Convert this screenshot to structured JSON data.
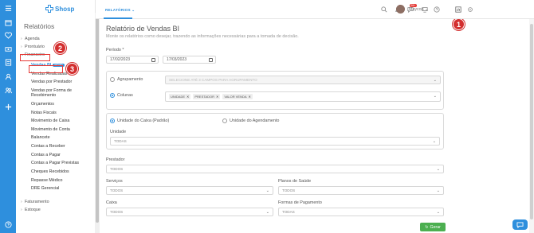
{
  "brand": {
    "name": "Shosp"
  },
  "sidebar": {
    "title": "Relatórios",
    "items": [
      {
        "label": "Agenda",
        "type": "section"
      },
      {
        "label": "Prontuário",
        "type": "section"
      },
      {
        "label": "Financeiro",
        "type": "section-open"
      }
    ],
    "financeiro_items": [
      {
        "label": "Vendas BI",
        "badge": "NOVO"
      },
      {
        "label": "Vendas Realizadas"
      },
      {
        "label": "Vendas por Prestador"
      },
      {
        "label": "Vendas por Forma de Recebimento"
      },
      {
        "label": "Orçamentos"
      },
      {
        "label": "Notas Fiscais"
      },
      {
        "label": "Movimento de Caixa"
      },
      {
        "label": "Movimento de Conta"
      },
      {
        "label": "Balancete"
      },
      {
        "label": "Contas a Receber"
      },
      {
        "label": "Contas a Pagar"
      },
      {
        "label": "Contas a Pagar Previstas"
      },
      {
        "label": "Cheques Recebidos"
      },
      {
        "label": "Repasse Médico"
      },
      {
        "label": "DRE Gerencial"
      }
    ],
    "bottom_items": [
      {
        "label": "Faturamento"
      },
      {
        "label": "Estoque"
      }
    ]
  },
  "annotations": {
    "one": "1",
    "two": "2",
    "three": "3"
  },
  "topbar": {
    "tab": "RELATÓRIOS",
    "badge_count": "99+",
    "user_name": "Maycon"
  },
  "main": {
    "title": "Relatório de Vendas BI",
    "subtitle": "Monte os relatórios como desejar, trazendo as informações necessárias para a tomada de decisão.",
    "periodo_label": "Período *",
    "date_start": "17/02/2023",
    "date_end": "17/03/2023",
    "agrupamento_label": "Agrupamento",
    "agrupamento_placeholder": "SELECIONE ATÉ 3 CAMPOS PARA AGRUPAMENTO",
    "colunas_label": "Colunas",
    "colunas_chips": [
      "UNIDADE",
      "PRESTADOR",
      "VALOR VENDA"
    ],
    "unidade_caixa_label": "Unidade do Caixa (Padrão)",
    "unidade_agendamento_label": "Unidade do Agendamento",
    "unidade_label": "Unidade",
    "unidade_value": "TODAS",
    "prestador_label": "Prestador",
    "prestador_value": "TODOS",
    "servicos_label": "Serviços",
    "servicos_value": "TODOS",
    "planos_label": "Planos de Saúde",
    "planos_value": "TODOS",
    "caixa_label": "Caixa",
    "caixa_value": "TODOS",
    "formas_label": "Formas de Pagamento",
    "formas_value": "TODAS",
    "gerar_label": "Gerar"
  }
}
